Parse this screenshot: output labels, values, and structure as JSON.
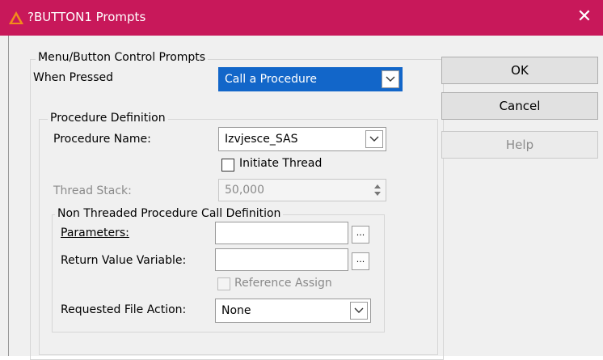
{
  "window": {
    "title": "?BUTTON1 Prompts",
    "close_symbol": "✕",
    "colors": {
      "titlebar": "#c8185a",
      "selection": "#1266c9"
    }
  },
  "main_group": {
    "legend": "Menu/Button Control Prompts",
    "when_pressed_label": "When Pressed",
    "when_pressed_value": "Call a Procedure"
  },
  "procedure_group": {
    "legend": "Procedure Definition",
    "procedure_name_label": "Procedure Name:",
    "procedure_name_value": "Izvjesce_SAS",
    "initiate_thread_label": "Initiate Thread",
    "initiate_thread_checked": false,
    "thread_stack_label": "Thread Stack:",
    "thread_stack_value": "50,000"
  },
  "non_threaded_group": {
    "legend": "Non Threaded Procedure Call Definition",
    "parameters_label": "Parameters:",
    "parameters_value": "",
    "return_value_label": "Return Value Variable:",
    "return_value_value": "",
    "ellipsis": "...",
    "reference_assign_label": "Reference Assign",
    "reference_assign_checked": false,
    "requested_file_action_label": "Requested File Action:",
    "requested_file_action_value": "None"
  },
  "buttons": {
    "ok": "OK",
    "cancel": "Cancel",
    "help": "Help"
  },
  "icons": {
    "app": "clarion-app-icon",
    "dropdown": "chevron-down-icon",
    "spinner": "spin-updown-icon",
    "close": "close-icon"
  }
}
